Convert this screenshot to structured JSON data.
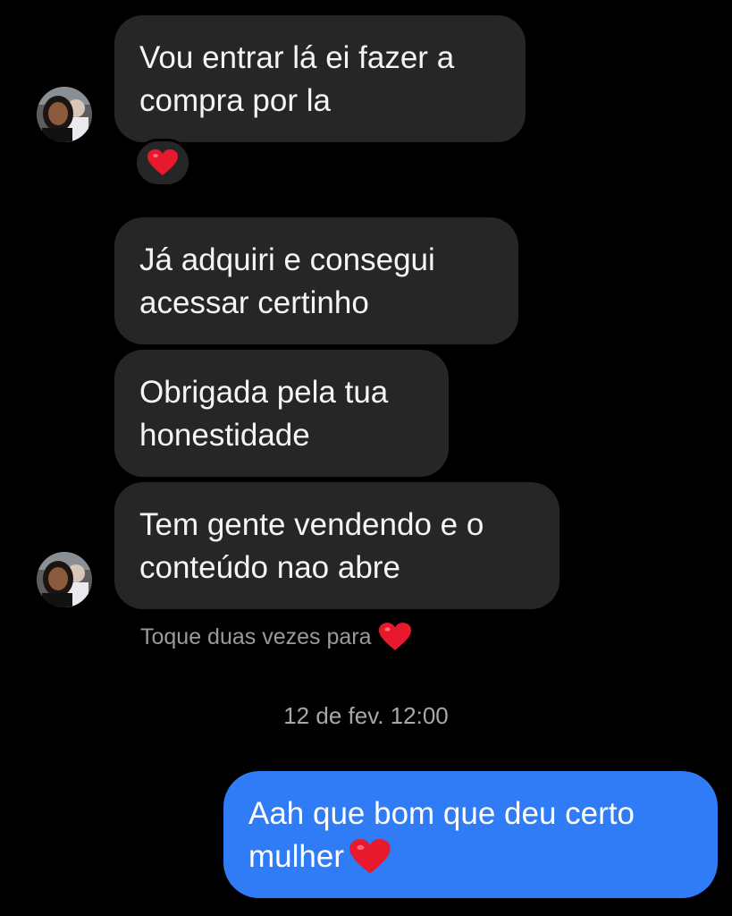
{
  "messages": [
    {
      "lines": [
        "Vou entrar lá ei fazer a",
        "compra por la"
      ],
      "reaction": "heart"
    },
    {
      "lines": [
        "Já adquiri  e consegui",
        "acessar certinho"
      ]
    },
    {
      "lines": [
        "Obrigada pela tua",
        "honestidade"
      ]
    },
    {
      "lines": [
        "Tem gente vendendo e o",
        "conteúdo nao abre"
      ]
    }
  ],
  "hint": {
    "text": "Toque duas vezes para",
    "icon": "heart-icon"
  },
  "timestamp": "12 de fev. 12:00",
  "sent": {
    "lines": [
      "Aah que bom que deu certo",
      "mulher"
    ],
    "emoji": "heart-icon"
  },
  "colors": {
    "background": "#000000",
    "received_bubble": "#262626",
    "sent_bubble": "#2f7cf6",
    "heart": "#e8192c",
    "secondary_text": "#9a9a9a"
  }
}
